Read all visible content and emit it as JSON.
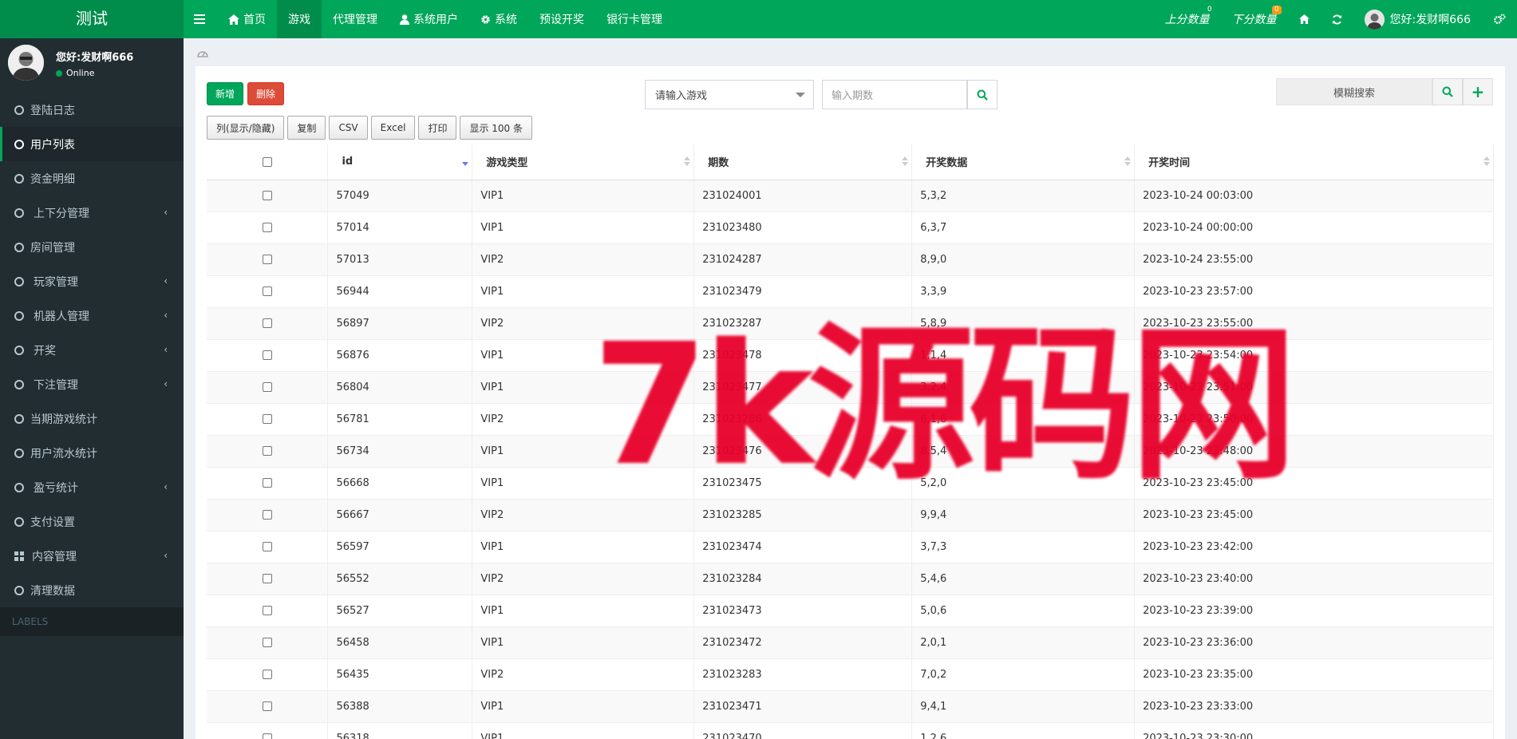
{
  "app": {
    "title": "测试"
  },
  "topnav": {
    "items": [
      {
        "label": "首页",
        "icon": "home-icon"
      },
      {
        "label": "游戏",
        "icon": ""
      },
      {
        "label": "代理管理",
        "icon": ""
      },
      {
        "label": "系统用户",
        "icon": "user-icon"
      },
      {
        "label": "系统",
        "icon": "gear-icon"
      },
      {
        "label": "预设开奖",
        "icon": ""
      },
      {
        "label": "银行卡管理",
        "icon": ""
      }
    ],
    "active_index": 1,
    "up_score": {
      "label": "上分数量",
      "badge": "0"
    },
    "down_score": {
      "label": "下分数量",
      "badge": "0"
    },
    "user_label": "您好:发财啊666"
  },
  "sidebar": {
    "user_name": "您好:发财啊666",
    "status": "Online",
    "items": [
      {
        "label": "登陆日志"
      },
      {
        "label": "用户列表"
      },
      {
        "label": "资金明细"
      },
      {
        "label": "上下分管理"
      },
      {
        "label": "房间管理"
      },
      {
        "label": "玩家管理"
      },
      {
        "label": "机器人管理"
      },
      {
        "label": "开奖"
      },
      {
        "label": "下注管理"
      },
      {
        "label": "当期游戏统计"
      },
      {
        "label": "用户流水统计"
      },
      {
        "label": "盈亏统计"
      },
      {
        "label": "支付设置"
      },
      {
        "label": "内容管理"
      },
      {
        "label": "清理数据"
      }
    ],
    "labels_header": "LABELS"
  },
  "toolbar": {
    "new_label": "新增",
    "delete_label": "删除",
    "game_select_value": "请输入游戏",
    "period_placeholder": "输入期数",
    "fuzzy_placeholder": "模糊搜索",
    "buttons": [
      "列(显示/隐藏)",
      "复制",
      "CSV",
      "Excel",
      "打印",
      "显示 100 条"
    ]
  },
  "table": {
    "headers": [
      "id",
      "游戏类型",
      "期数",
      "开奖数据",
      "开奖时间"
    ],
    "rows": [
      [
        "57049",
        "VIP1",
        "231024001",
        "5,3,2",
        "2023-10-24 00:03:00"
      ],
      [
        "57014",
        "VIP1",
        "231023480",
        "6,3,7",
        "2023-10-24 00:00:00"
      ],
      [
        "57013",
        "VIP2",
        "231024287",
        "8,9,0",
        "2023-10-24 23:55:00"
      ],
      [
        "56944",
        "VIP1",
        "231023479",
        "3,3,9",
        "2023-10-23 23:57:00"
      ],
      [
        "56897",
        "VIP2",
        "231023287",
        "5,8,9",
        "2023-10-23 23:55:00"
      ],
      [
        "56876",
        "VIP1",
        "231023478",
        "1,1,4",
        "2023-10-23 23:54:00"
      ],
      [
        "56804",
        "VIP1",
        "231023477",
        "3,2,4",
        "2023-10-23 23:51:00"
      ],
      [
        "56781",
        "VIP2",
        "231023286",
        "6,1,6",
        "2023-10-23 23:50:00"
      ],
      [
        "56734",
        "VIP1",
        "231023476",
        "8,5,4",
        "2023-10-23 23:48:00"
      ],
      [
        "56668",
        "VIP1",
        "231023475",
        "5,2,0",
        "2023-10-23 23:45:00"
      ],
      [
        "56667",
        "VIP2",
        "231023285",
        "9,9,4",
        "2023-10-23 23:45:00"
      ],
      [
        "56597",
        "VIP1",
        "231023474",
        "3,7,3",
        "2023-10-23 23:42:00"
      ],
      [
        "56552",
        "VIP2",
        "231023284",
        "5,4,6",
        "2023-10-23 23:40:00"
      ],
      [
        "56527",
        "VIP1",
        "231023473",
        "5,0,6",
        "2023-10-23 23:39:00"
      ],
      [
        "56458",
        "VIP1",
        "231023472",
        "2,0,1",
        "2023-10-23 23:36:00"
      ],
      [
        "56435",
        "VIP2",
        "231023283",
        "7,0,2",
        "2023-10-23 23:35:00"
      ],
      [
        "56388",
        "VIP1",
        "231023471",
        "9,4,1",
        "2023-10-23 23:33:00"
      ],
      [
        "56318",
        "VIP1",
        "231023470",
        "1,2,6",
        "2023-10-23 23:30:00"
      ]
    ]
  },
  "watermark": {
    "text": "7k源码网"
  },
  "colors": {
    "primary": "#00a65a",
    "primary_dark": "#008d4c",
    "danger": "#dd4b39",
    "sidebar": "#222d32",
    "watermark": "#e8002a"
  }
}
